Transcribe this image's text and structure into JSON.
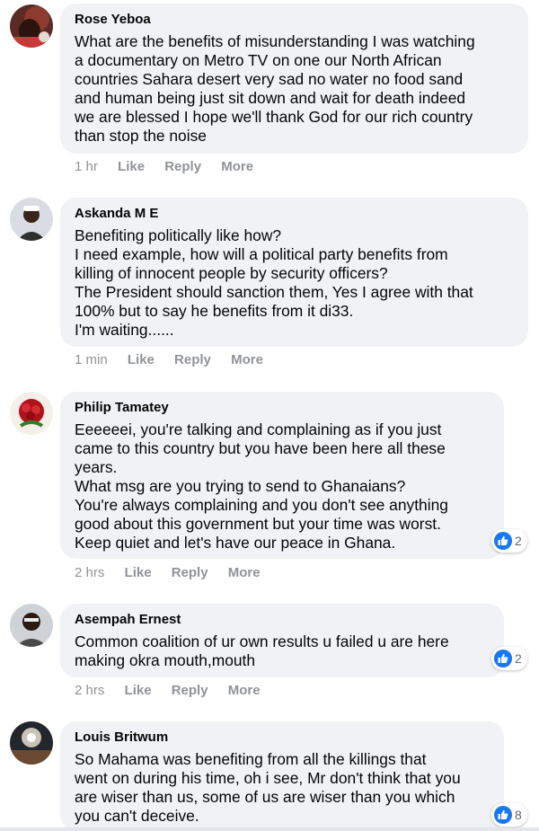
{
  "comments": [
    {
      "author": "Rose Yeboa",
      "text": "What are the benefits of misunderstanding I was watching\na documentary on Metro TV on one our North African\ncountries Sahara desert very sad no water no food sand\nand human being just sit down and wait for death indeed\nwe are blessed I hope we'll thank God for our rich country\nthan stop the noise",
      "time": "1 hr",
      "like": "Like",
      "reply": "Reply",
      "more": "More"
    },
    {
      "author": "Askanda M E",
      "text": "Benefiting politically like how?\nI need example, how will a political party benefits from\nkilling of innocent people by security officers?\nThe President should sanction them, Yes I agree with that\n100% but to say he benefits from it di33.\nI'm waiting......",
      "time": "1 min",
      "like": "Like",
      "reply": "Reply",
      "more": "More"
    },
    {
      "author": "Philip Tamatey",
      "text": "Eeeeeei, you're talking and complaining as if you just\ncame to this country but you have been here all these\nyears.\nWhat msg are you trying to send to Ghanaians?\nYou're always complaining and you don't see anything\ngood about this government but your time was worst.\nKeep quiet and let's have our peace in Ghana.",
      "time": "2 hrs",
      "like": "Like",
      "reply": "Reply",
      "more": "More",
      "reactions": "2"
    },
    {
      "author": "Asempah Ernest",
      "text": "Common coalition of ur own results u failed u are here\nmaking okra mouth,mouth",
      "time": "2 hrs",
      "like": "Like",
      "reply": "Reply",
      "more": "More",
      "reactions": "2"
    },
    {
      "author": "Louis Britwum",
      "text": "So Mahama was benefiting from all the killings that\nwent on during his time, oh i see, Mr don't think that you\nare wiser than us, some of us are wiser than you which\nyou can't deceive.",
      "reactions": "8"
    }
  ],
  "colors": {
    "bubble": "#f0f2f5",
    "action_text": "#909399",
    "like_blue": "#1877f2"
  },
  "icons": {
    "reaction": "like-thumb-icon"
  }
}
